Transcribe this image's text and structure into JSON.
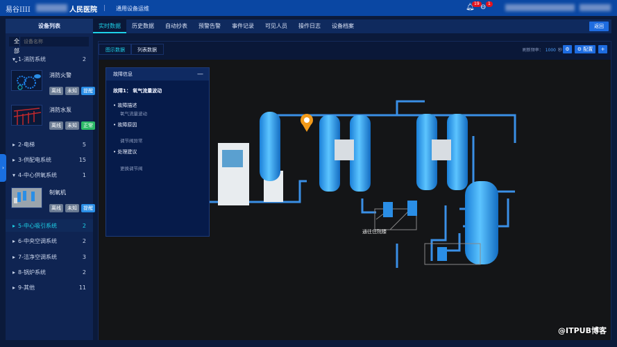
{
  "header": {
    "logo": "易谷IIII",
    "hospital": "人民医院",
    "subtitle": "通用设备运维",
    "notifications": "19",
    "messages": "1"
  },
  "sidebar": {
    "title": "设备列表",
    "filter": "全部",
    "search_placeholder": "设备名称",
    "groups": [
      {
        "label": "1-消防系统",
        "count": "2"
      },
      {
        "label": "2-电梯",
        "count": "5"
      },
      {
        "label": "3-供配电系统",
        "count": "15"
      },
      {
        "label": "4-中心供氧系统",
        "count": "1"
      },
      {
        "label": "5-中心吸引系统",
        "count": "2"
      },
      {
        "label": "6-中央空调系统",
        "count": "2"
      },
      {
        "label": "7-洁净空调系统",
        "count": "3"
      },
      {
        "label": "8-锅炉系统",
        "count": "2"
      },
      {
        "label": "9-其他",
        "count": "11"
      }
    ],
    "devices": [
      {
        "name": "消防火警",
        "tags": [
          "离线",
          "未知",
          "提醒"
        ]
      },
      {
        "name": "消防水泵",
        "tags": [
          "离线",
          "未知",
          "正常"
        ]
      },
      {
        "name": "制氧机",
        "tags": [
          "离线",
          "未知",
          "提醒"
        ]
      }
    ]
  },
  "tabs": [
    "实时数据",
    "历史数据",
    "自动抄表",
    "预警告警",
    "事件记录",
    "可见人员",
    "操作日志",
    "设备档案"
  ],
  "back_label": "返回",
  "subtabs": [
    "图示数据",
    "列表数据"
  ],
  "refresh": {
    "label": "刷新频率：",
    "value": "1000",
    "unit": "秒"
  },
  "config_label": "配置",
  "fault": {
    "title": "故障信息",
    "name": "故障1： 氧气流量波动",
    "sections": [
      {
        "label": "故障描述",
        "value": "氧气流量波动"
      },
      {
        "label": "故障原因",
        "value": "调节阀异常"
      },
      {
        "label": "处理建议",
        "value": "更换调节阀"
      }
    ]
  },
  "scene_label": "通往住院楼",
  "watermark": "@ITPUB博客"
}
